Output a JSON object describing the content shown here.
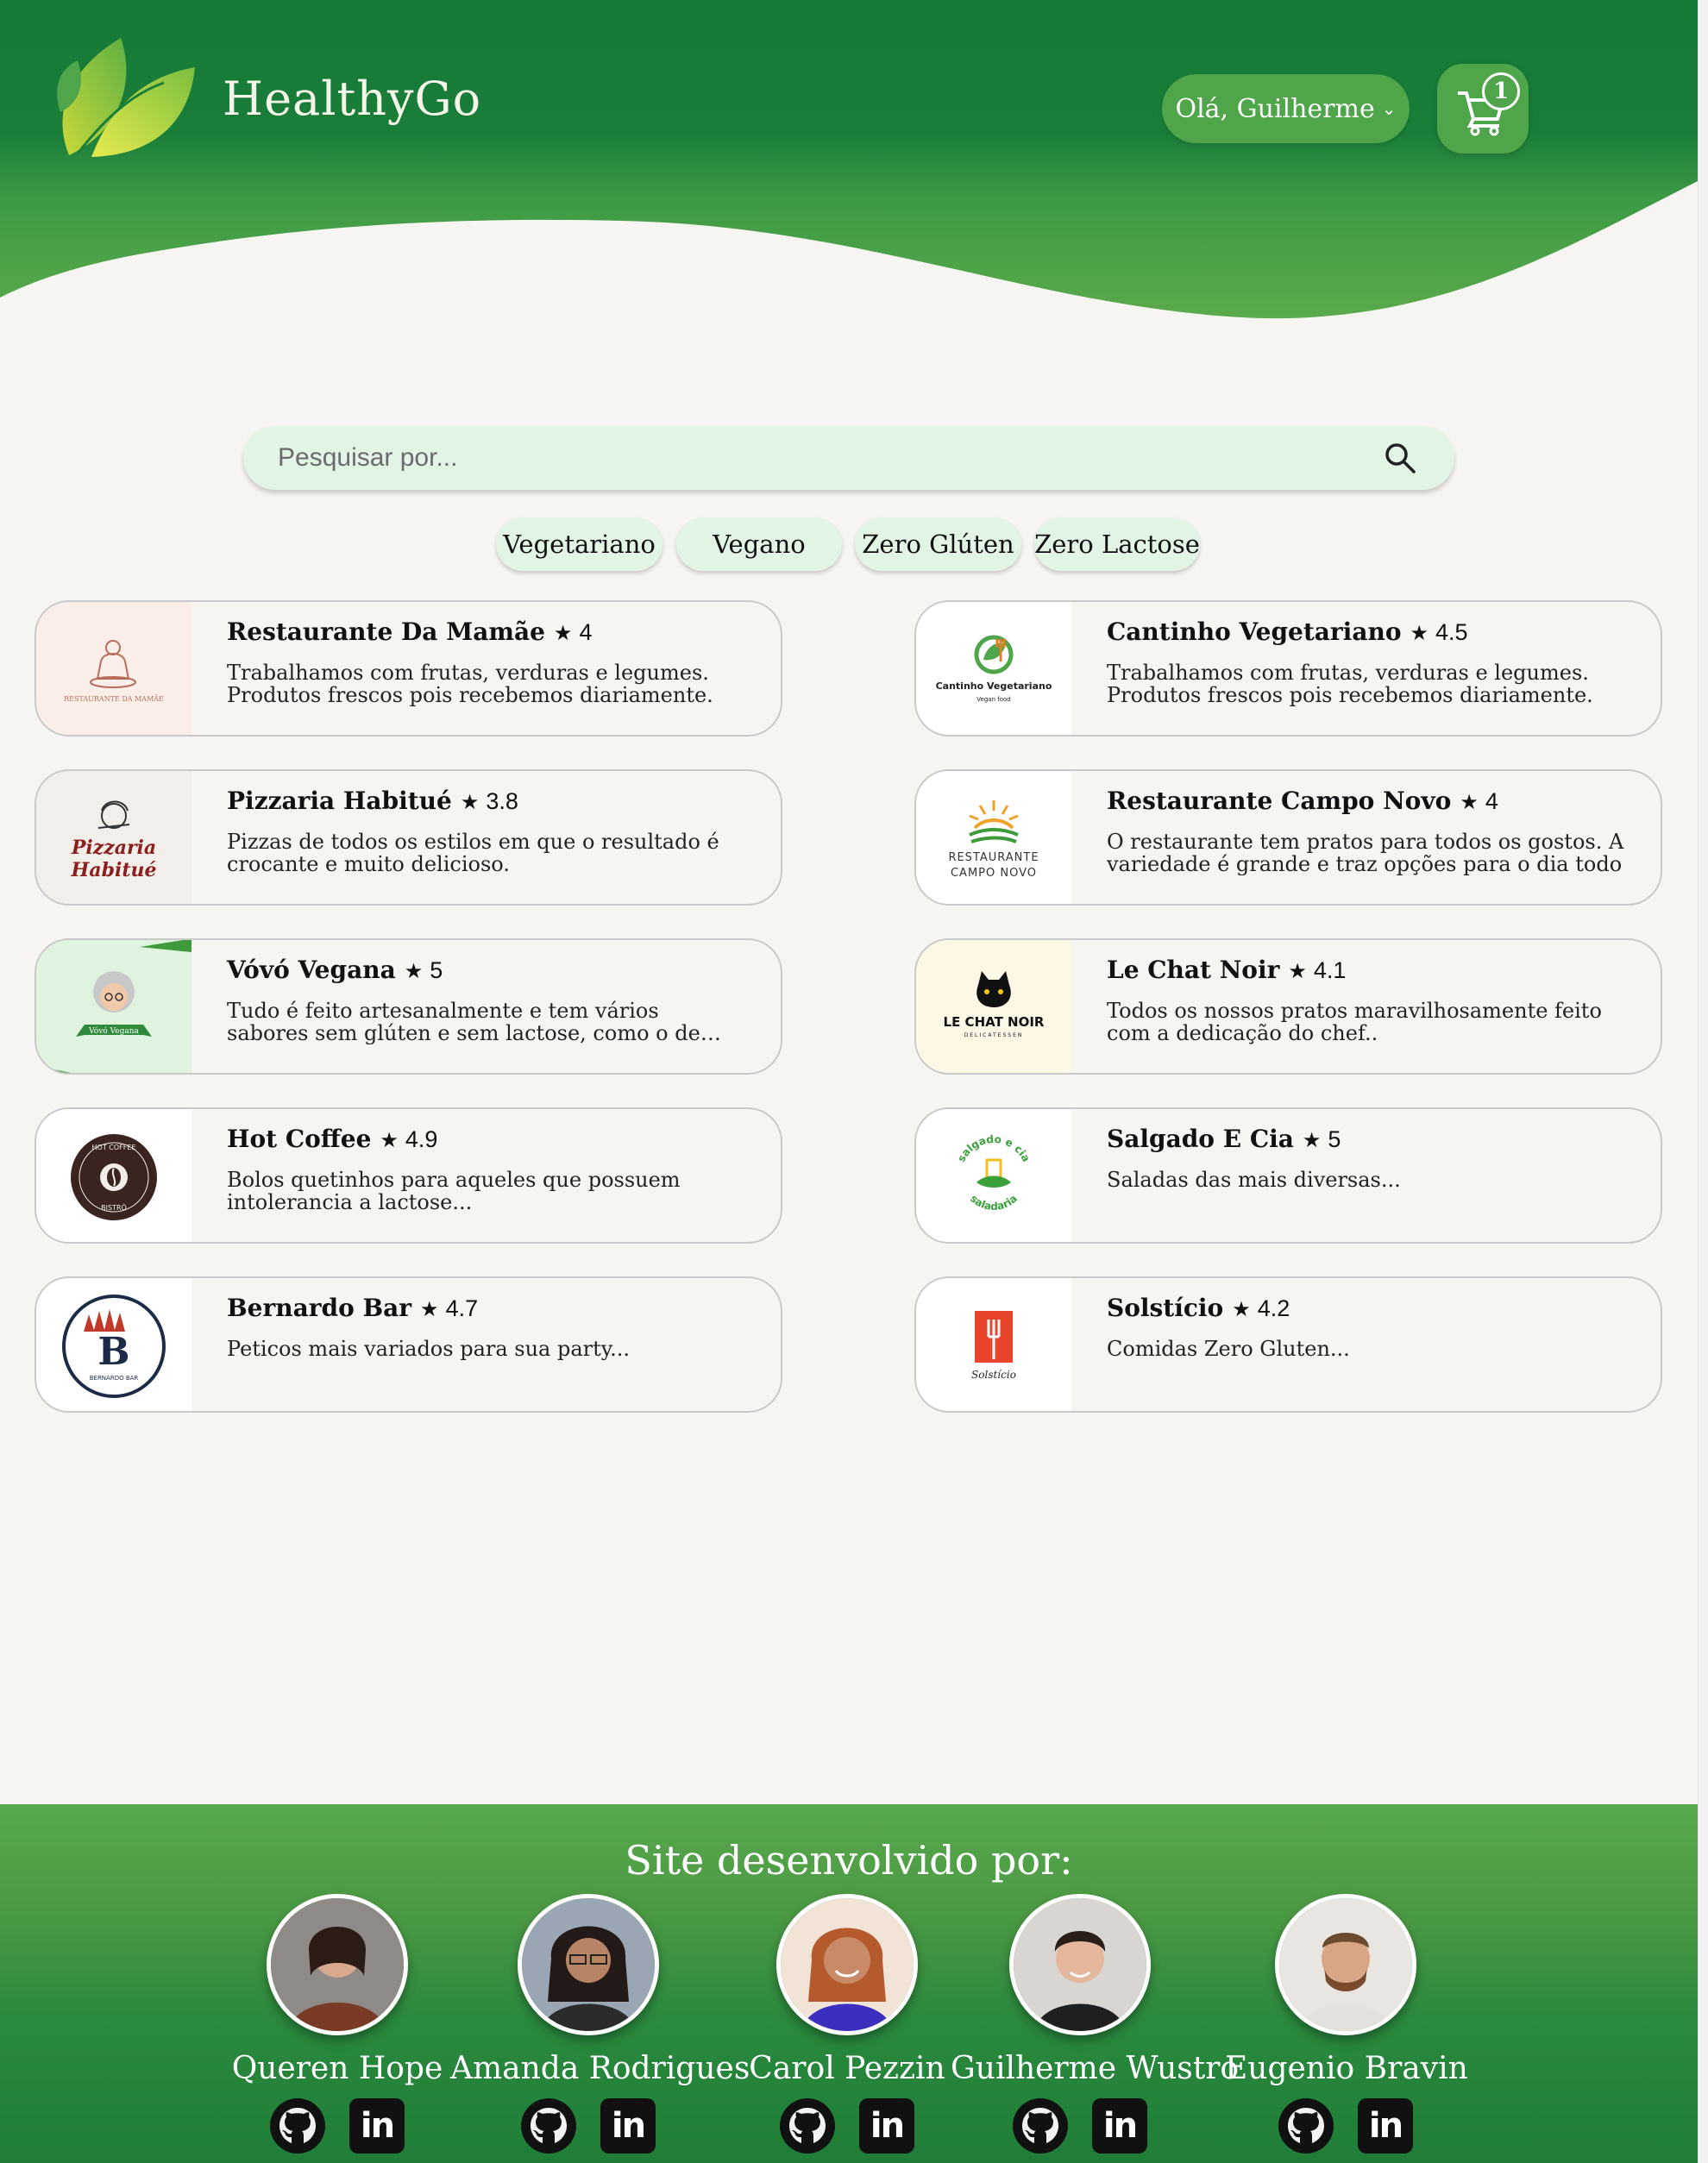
{
  "header": {
    "brand": "HealthyGo",
    "greeting": "Olá, Guilherme",
    "cart_count": "1"
  },
  "search": {
    "placeholder": "Pesquisar por..."
  },
  "filters": [
    "Vegetariano",
    "Vegano",
    "Zero Glúten",
    "Zero Lactose"
  ],
  "restaurants": [
    {
      "name": "Restaurante Da Mamãe",
      "rating": "4",
      "logo_text": "RESTAURANTE DA MAMÃE",
      "desc": "Trabalhamos com frutas, verduras e legumes. Produtos frescos pois recebemos diariamente."
    },
    {
      "name": "Cantinho Vegetariano",
      "rating": "4.5",
      "logo_text": "Cantinho Vegetariano",
      "logo_sub": "Vegan food",
      "desc": "Trabalhamos com frutas, verduras e legumes. Produtos frescos pois recebemos diariamente."
    },
    {
      "name": "Pizzaria Habitué",
      "rating": "3.8",
      "logo_text": "Pizzaria Habitué",
      "desc": "Pizzas de todos os estilos em que o resultado é crocante e muito delicioso."
    },
    {
      "name": "Restaurante Campo Novo",
      "rating": "4",
      "logo_text": "RESTAURANTE CAMPO NOVO",
      "desc": "O restaurante tem pratos para todos os gostos. A variedade é grande e traz opções para o dia todo"
    },
    {
      "name": "Vóvó Vegana",
      "rating": "5",
      "logo_text": "Vóvó Vegana",
      "desc": "Tudo é feito artesanalmente e tem vários sabores sem glúten e sem lactose, como o de lichia, leite d..."
    },
    {
      "name": "Le Chat Noir",
      "rating": "4.1",
      "logo_text": "LE CHAT NOIR",
      "logo_sub": "DELICATESSEN",
      "desc": "Todos os nossos pratos maravilhosamente feito com a dedicação do chef.."
    },
    {
      "name": "Hot Coffee",
      "rating": "4.9",
      "logo_text": "HOT COFFEE",
      "logo_sub": "BISTRÔ",
      "desc": "Bolos quetinhos para aqueles que possuem intolerancia a lactose..."
    },
    {
      "name": "Salgado E Cia",
      "rating": "5",
      "logo_text": "salgado e cia",
      "logo_sub": "saladaria",
      "desc": "Saladas das mais diversas..."
    },
    {
      "name": "Bernardo Bar",
      "rating": "4.7",
      "logo_text": "BERNARDO BAR",
      "desc": "Peticos mais variados para sua party..."
    },
    {
      "name": "Solstício",
      "rating": "4.2",
      "logo_text": "Solstício",
      "desc": "Comidas Zero Gluten..."
    }
  ],
  "footer": {
    "title": "Site desenvolvido por:",
    "developers": [
      {
        "name": "Queren Hope"
      },
      {
        "name": "Amanda Rodrigues"
      },
      {
        "name": "Carol Pezzin"
      },
      {
        "name": "Guilherme Wustro"
      },
      {
        "name": "Eugenio Bravin"
      }
    ]
  },
  "colors": {
    "header_dark": "#167a38",
    "header_light": "#59a94a",
    "button_green": "#4fa54a",
    "chip_bg": "#e2f5e4",
    "page_bg": "#f7f5f1"
  }
}
